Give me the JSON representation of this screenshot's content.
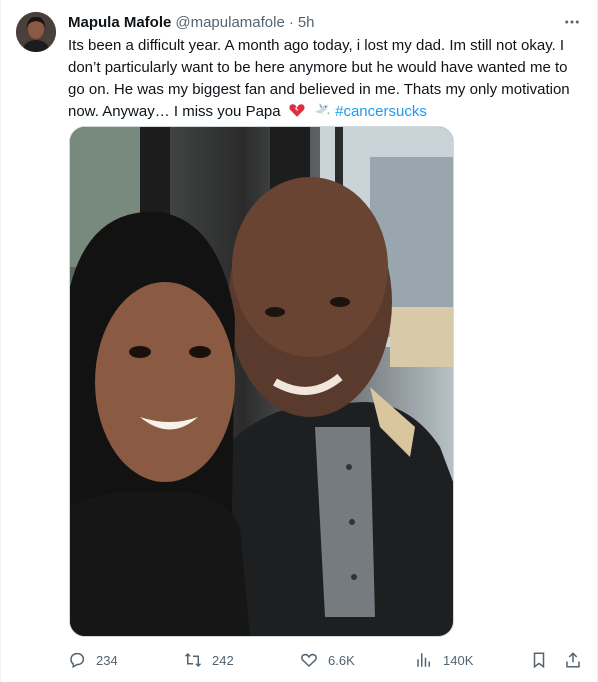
{
  "tweet": {
    "author_name": "Mapula Mafole",
    "handle": "@mapulamafole",
    "separator": "·",
    "time": "5h",
    "text_main": "Its been a difficult year. A month ago today, i lost my dad. Im still not okay. I don’t particularly want to be here anymore but he would have wanted me to go on. He was my biggest fan and believed in me. Thats my only motivation now. Anyway… I miss you Papa",
    "hashtag": "#cancersucks",
    "emojis": [
      "broken-heart-icon",
      "dove-icon"
    ]
  },
  "actions": {
    "replies": "234",
    "retweets": "242",
    "likes": "6.6K",
    "views": "140K"
  },
  "colors": {
    "text": "#0f1419",
    "secondary": "#536471",
    "link": "#1d9bf0",
    "border": "#cfd9de"
  }
}
